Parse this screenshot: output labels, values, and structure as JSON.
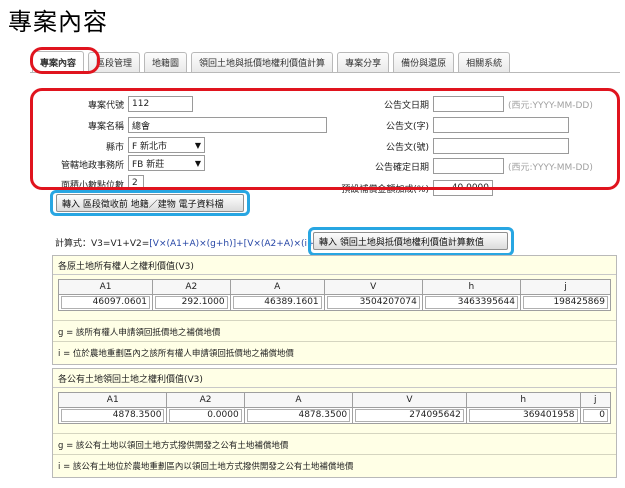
{
  "page_title": "專案內容",
  "tabs": [
    {
      "label": "專案內容",
      "active": true
    },
    {
      "label": "區段管理",
      "active": false
    },
    {
      "label": "地籍圖",
      "active": false
    },
    {
      "label": "領回土地與抵價地權利價值計算",
      "active": false
    },
    {
      "label": "專案分享",
      "active": false
    },
    {
      "label": "備份與還原",
      "active": false
    },
    {
      "label": "相關系統",
      "active": false
    }
  ],
  "form": {
    "project_code_label": "專案代號",
    "project_code_value": "112",
    "project_name_label": "專案名稱",
    "project_name_value": "總會",
    "city_label": "縣市",
    "city_value": "F 新北市",
    "land_office_label": "管轄地政事務所",
    "land_office_value": "FB 新莊",
    "decimal_label": "面積小數點位數",
    "decimal_value": "2",
    "announce_date_label": "公告文日期",
    "announce_date_value": "",
    "announce_date_hint": "(西元:YYYY-MM-DD)",
    "announce_word_label": "公告文(字)",
    "announce_word_value": "",
    "announce_no_label": "公告文(號)",
    "announce_no_value": "",
    "confirm_date_label": "公告確定日期",
    "confirm_date_value": "",
    "confirm_date_hint": "(西元:YYYY-MM-DD)",
    "compensation_label": "預設補償金額加成(%)",
    "compensation_value": "40.0000"
  },
  "buttons": {
    "import_cadastral": "轉入 區段徵收前 地籍／建物 電子資料檔",
    "import_rights": "轉入 領回土地與抵價地權利價值計算數值"
  },
  "formula": {
    "prefix": "計算式：",
    "plain": "V3=V1+V2=",
    "blue": "[V×(A1+A)×(g+h)]+[V×(A2+A)×(i+j)]"
  },
  "panel1": {
    "title": "各原土地所有權人之權利價值(V3)",
    "headers": [
      "A1",
      "A2",
      "A",
      "V",
      "h",
      "j"
    ],
    "values": [
      "46097.0601",
      "292.1000",
      "46389.1601",
      "3504207074",
      "3463395644",
      "198425869"
    ],
    "note_g": "g = 該所有權人申請領回抵價地之補償地價",
    "note_i": "i = 位於農地重劃區內之該所有權人申請領回抵價地之補償地價"
  },
  "panel2": {
    "title": "各公有土地領回土地之權利價值(V3)",
    "headers": [
      "A1",
      "A2",
      "A",
      "V",
      "h",
      "j"
    ],
    "values": [
      "4878.3500",
      "0.0000",
      "4878.3500",
      "274095642",
      "369401958",
      "0"
    ],
    "note_g": "g = 該公有土地以領回土地方式撥供開發之公有土地補償地價",
    "note_i": "i = 該公有土地位於農地重劃區內以領回土地方式撥供開發之公有土地補償地價"
  },
  "colors": {
    "highlight_red": "#e0141e",
    "highlight_blue": "#28a6e2",
    "panel_bg": "#ffffe6",
    "formula_blue": "#2747a6",
    "hint_gray": "#a0a0a0"
  }
}
